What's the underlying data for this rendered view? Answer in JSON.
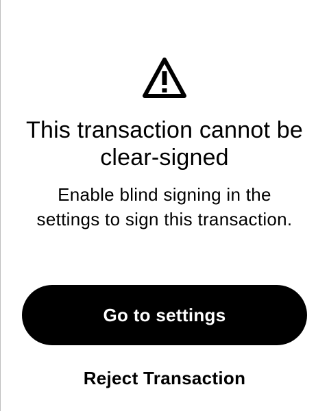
{
  "screen": {
    "icon": "warning-icon",
    "title": "This transaction cannot be clear-signed",
    "message": "Enable blind signing in the settings to sign this transaction.",
    "primary_button_label": "Go to settings",
    "secondary_action_label": "Reject Transaction"
  },
  "colors": {
    "background": "#ffffff",
    "text": "#000000",
    "button_background": "#000000",
    "button_text": "#ffffff"
  }
}
